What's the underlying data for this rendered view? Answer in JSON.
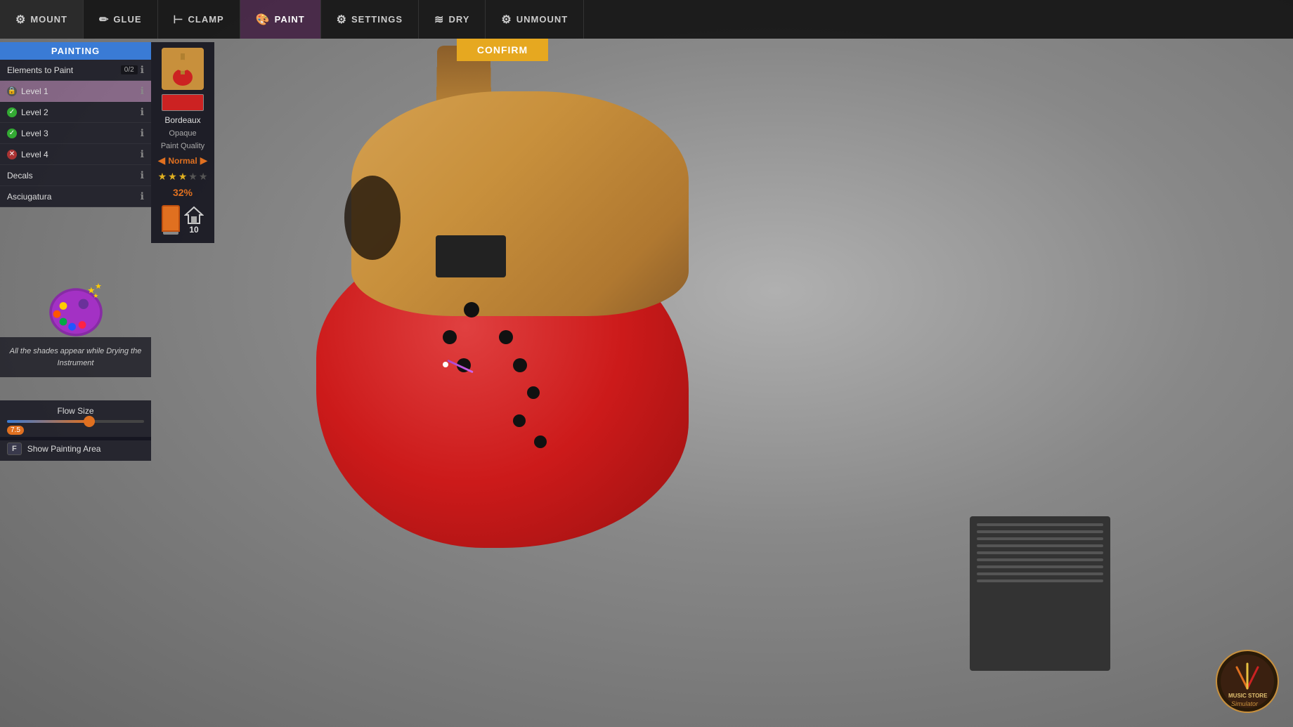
{
  "topbar": {
    "items": [
      {
        "id": "mount",
        "label": "MOUNT",
        "icon": "⚙",
        "active": false
      },
      {
        "id": "glue",
        "label": "GLUE",
        "icon": "✏",
        "active": false
      },
      {
        "id": "clamp",
        "label": "CLAMP",
        "icon": "⊢",
        "active": false
      },
      {
        "id": "paint",
        "label": "PAINT",
        "icon": "🎨",
        "active": true
      },
      {
        "id": "settings",
        "label": "SETTINGS",
        "icon": "⚙",
        "active": false
      },
      {
        "id": "dry",
        "label": "DRY",
        "icon": "≋",
        "active": false
      },
      {
        "id": "unmount",
        "label": "UNMOUNT",
        "icon": "⚙",
        "active": false
      }
    ],
    "confirm_label": "CONFIRM"
  },
  "left_panel": {
    "title": "PAINTING",
    "elements_label": "Elements to Paint",
    "elements_count": "0/2",
    "levels": [
      {
        "label": "Level 1",
        "status": "lock"
      },
      {
        "label": "Level 2",
        "status": "check"
      },
      {
        "label": "Level 3",
        "status": "check"
      },
      {
        "label": "Level 4",
        "status": "x"
      }
    ],
    "decals_label": "Decals",
    "asciugatura_label": "Asciugatura"
  },
  "color_panel": {
    "color_name": "Bordeaux",
    "opacity_label": "Opaque",
    "quality_label": "Paint Quality",
    "quality_value": "Normal",
    "stars_filled": 3,
    "stars_total": 5,
    "percent": "32%",
    "count": "10"
  },
  "info_text": "All the shades appear while Drying the Instrument",
  "flow": {
    "label": "Flow Size",
    "value": "7.5",
    "percent": 60
  },
  "show_painting": {
    "key": "F",
    "label": "Show Painting Area"
  },
  "logo": {
    "top_text": "MUSIC STORE",
    "bottom_text": "Simulator"
  }
}
